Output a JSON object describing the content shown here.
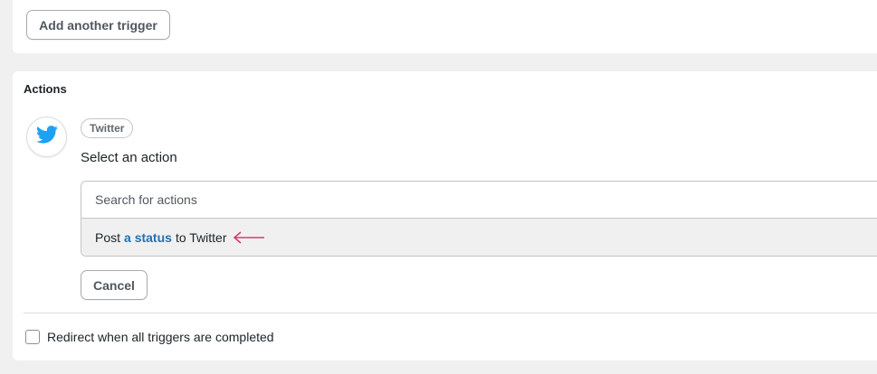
{
  "triggers": {
    "add_button_label": "Add another trigger"
  },
  "actions": {
    "title": "Actions",
    "integration": {
      "icon": "twitter-bird-icon",
      "icon_color": "#1da1f2",
      "chip_label": "Twitter",
      "select_label": "Select an action"
    },
    "search": {
      "placeholder": "Search for actions"
    },
    "option": {
      "prefix": "Post",
      "highlight": "a status",
      "suffix": "to Twitter",
      "highlight_color": "#2271b1",
      "arrow_icon": "arrow-left-icon",
      "arrow_color": "#d63d6a"
    },
    "cancel_label": "Cancel",
    "redirect_label": "Redirect when all triggers are completed"
  }
}
